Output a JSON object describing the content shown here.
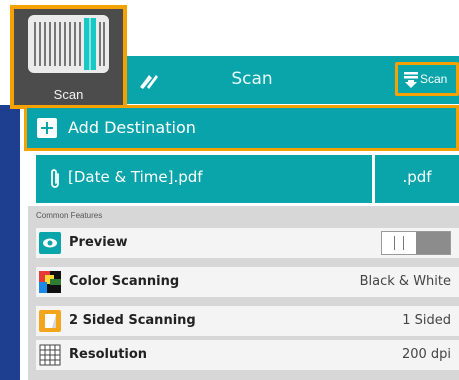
{
  "app": {
    "tile_label": "Scan",
    "icon": "scanner-app-icon"
  },
  "header": {
    "title": "Scan",
    "edit_icon": "edit-icon",
    "scan_button_label": "Scan",
    "scan_button_icon": "scan-arrow-icon"
  },
  "destination": {
    "add_label": "Add Destination",
    "add_icon": "plus-icon"
  },
  "file": {
    "name": "[Date & Time].pdf",
    "extension": ".pdf",
    "icon": "paperclip-icon"
  },
  "features": {
    "header": "Common Features",
    "items": [
      {
        "label": "Preview",
        "value": "",
        "icon": "preview-eye-icon",
        "control": "toggle"
      },
      {
        "label": "Color Scanning",
        "value": "Black & White",
        "icon": "color-scanning-icon"
      },
      {
        "label": "2 Sided Scanning",
        "value": "1 Sided",
        "icon": "two-sided-icon"
      },
      {
        "label": "Resolution",
        "value": "200 dpi",
        "icon": "resolution-grid-icon"
      }
    ]
  },
  "colors": {
    "teal": "#0aa4ab",
    "accent_orange": "#f5a100",
    "frame_blue": "#1e3f8f",
    "tile_dark": "#4c4c4c"
  }
}
